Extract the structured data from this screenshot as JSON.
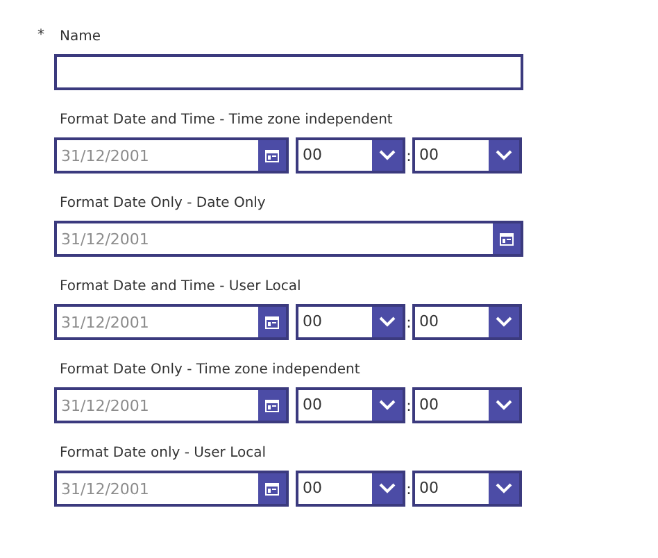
{
  "name_field": {
    "required_mark": "*",
    "label": "Name"
  },
  "fields": [
    {
      "kind": "datetime",
      "label": "Format Date and Time - Time zone independent",
      "date_placeholder": "31/12/2001",
      "hour": "00",
      "separator": ":",
      "minute": "00"
    },
    {
      "kind": "date",
      "label": "Format Date Only - Date Only",
      "date_placeholder": "31/12/2001"
    },
    {
      "kind": "datetime",
      "label": "Format Date and Time - User Local",
      "date_placeholder": "31/12/2001",
      "hour": "00",
      "separator": ":",
      "minute": "00"
    },
    {
      "kind": "datetime",
      "label": "Format Date Only - Time zone independent",
      "date_placeholder": "31/12/2001",
      "hour": "00",
      "separator": ":",
      "minute": "00"
    },
    {
      "kind": "datetime",
      "label": "Format Date only - User Local",
      "date_placeholder": "31/12/2001",
      "hour": "00",
      "separator": ":",
      "minute": "00"
    }
  ]
}
